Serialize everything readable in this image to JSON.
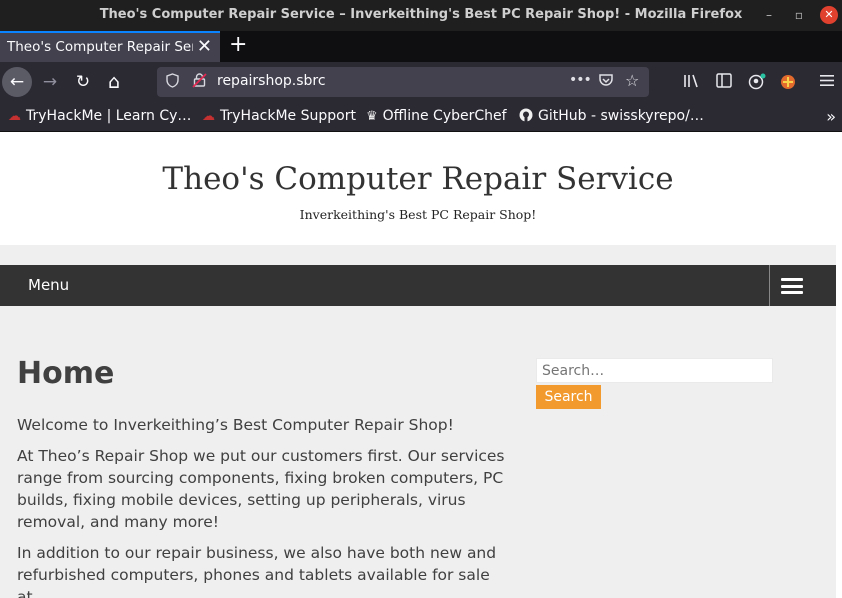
{
  "window": {
    "title": "Theo's Computer Repair Service – Inverkeithing's Best PC Repair Shop! - Mozilla Firefox",
    "minimize_icon": "–",
    "maximize_icon": "▫",
    "close_icon": "✕"
  },
  "tabs": [
    {
      "label": "Theo's Computer Repair Service",
      "close": "✕"
    }
  ],
  "newtab_icon": "+",
  "nav": {
    "back_icon": "←",
    "forward_icon": "→",
    "reload_icon": "↻",
    "home_icon": "⌂",
    "url": "repairshop.sbrc",
    "more_icon": "•••"
  },
  "bookmarks": [
    {
      "label": "TryHackMe | Learn Cy…",
      "icon": "tryhackme-icon"
    },
    {
      "label": "TryHackMe Support",
      "icon": "tryhackme-icon"
    },
    {
      "label": "Offline CyberChef",
      "icon": "chef-icon"
    },
    {
      "label": "GitHub - swisskyrepo/…",
      "icon": "github-icon"
    }
  ],
  "site": {
    "title": "Theo's Computer Repair Service",
    "tagline": "Inverkeithing's Best PC Repair Shop!",
    "menu_label": "Menu"
  },
  "content": {
    "heading": "Home",
    "paragraphs": [
      "Welcome to Inverkeithing’s Best Computer Repair Shop!",
      "At Theo’s Repair Shop we put our customers first. Our services range from sourcing components, fixing broken computers, PC builds, fixing mobile devices, setting up peripherals, virus removal, and many more!",
      "In addition to our repair business, we also have both new and refurbished computers, phones and tablets available for sale at"
    ]
  },
  "sidebar": {
    "search_placeholder": "Search…",
    "search_button": "Search"
  },
  "colors": {
    "accent_tab": "#0a84ff",
    "search_button": "#f29a2e",
    "menubar": "#333333"
  }
}
